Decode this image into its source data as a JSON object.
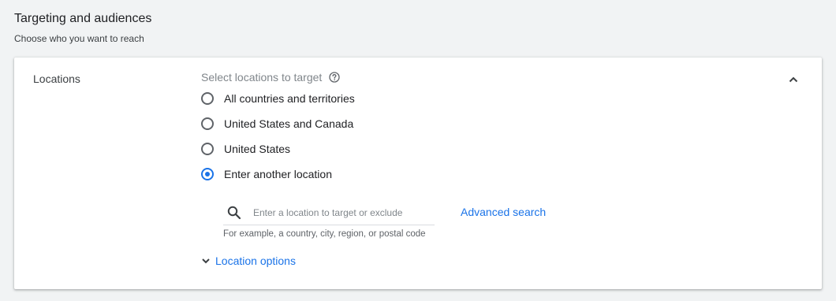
{
  "section": {
    "title": "Targeting and audiences",
    "subtitle": "Choose who you want to reach"
  },
  "locations": {
    "label": "Locations",
    "prompt": "Select locations to target",
    "help_icon": "help-circle-icon",
    "collapse_icon": "chevron-up-icon",
    "options": [
      {
        "label": "All countries and territories",
        "selected": false
      },
      {
        "label": "United States and Canada",
        "selected": false
      },
      {
        "label": "United States",
        "selected": false
      },
      {
        "label": "Enter another location",
        "selected": true
      }
    ],
    "search": {
      "icon": "search-icon",
      "placeholder": "Enter a location to target or exclude",
      "value": "",
      "helper": "For example, a country, city, region, or postal code"
    },
    "advanced_search_label": "Advanced search",
    "location_options_label": "Location options",
    "location_options_icon": "chevron-down-icon"
  },
  "colors": {
    "accent": "#1a73e8",
    "background": "#f1f3f4",
    "card": "#ffffff"
  }
}
